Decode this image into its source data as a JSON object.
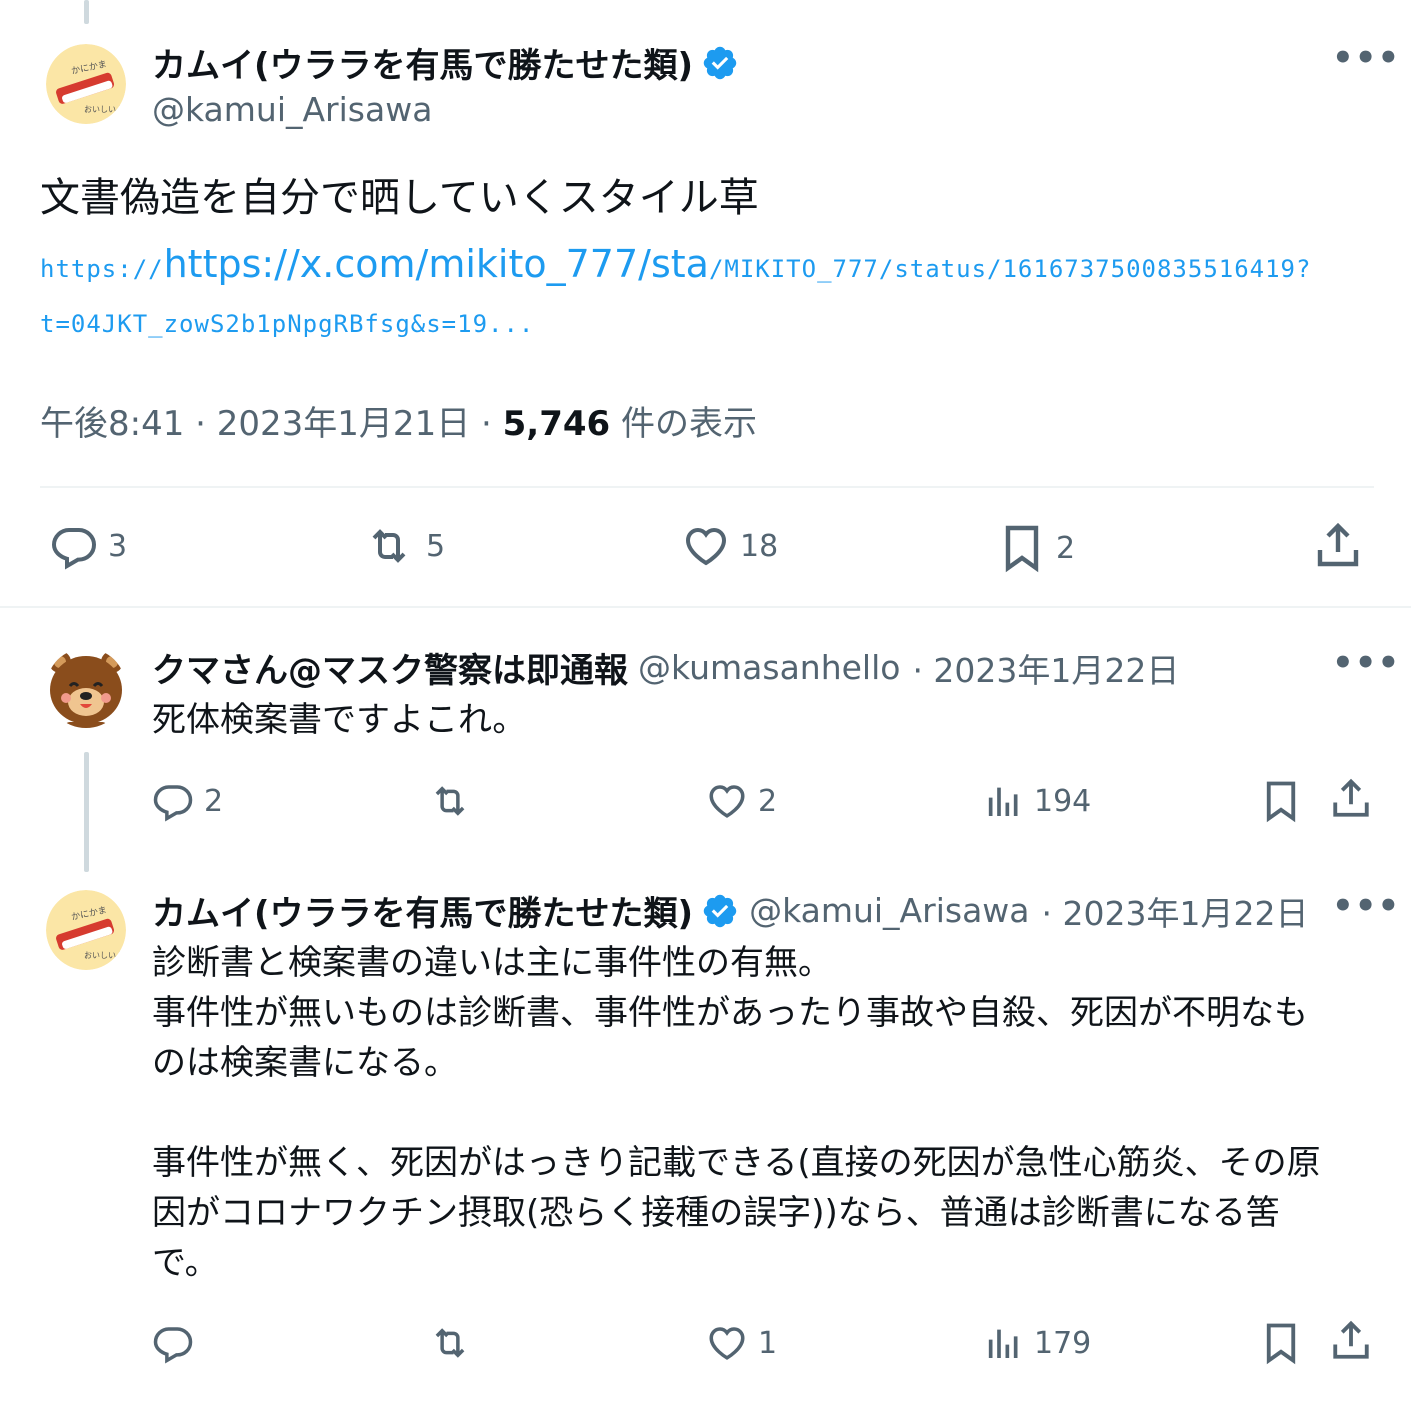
{
  "main_tweet": {
    "display_name": "カムイ(ウララを有馬で勝たせた類)",
    "handle": "@kamui_Arisawa",
    "text": "文書偽造を自分で晒していくスタイル草",
    "link_big": "https://x.com/mikito_777/sta",
    "link_rest": "/MIKITO_777/status/1616737500835516419?",
    "link_line2": "t=04JKT_zowS2b1pNpgRBfsg&s=19...",
    "time": "午後8:41 · 2023年1月21日 · ",
    "views_count": "5,746",
    "views_label": " 件の表示",
    "actions": {
      "replies": "3",
      "retweets": "5",
      "likes": "18",
      "bookmarks": "2"
    }
  },
  "reply1": {
    "display_name": "クマさん@マスク警察は即通報",
    "handle": "@kumasanhello",
    "date": "· 2023年1月22日",
    "text": "死体検案書ですよこれ。",
    "actions": {
      "replies": "2",
      "retweets": "",
      "likes": "2",
      "views": "194"
    }
  },
  "reply2": {
    "display_name": "カムイ(ウララを有馬で勝たせた類)",
    "handle": "@kamui_Arisawa",
    "date": "· 2023年1月22日",
    "text": "診断書と検案書の違いは主に事件性の有無。\n事件性が無いものは診断書、事件性があったり事故や自殺、死因が不明なも\nのは検案書になる。\n\n事件性が無く、死因がはっきり記載できる(直接の死因が急性心筋炎、その原\n因がコロナワクチン摂取(恐らく接種の誤字))なら、普通は診断書になる筈\nで。",
    "actions": {
      "replies": "",
      "retweets": "",
      "likes": "1",
      "views": "179"
    }
  },
  "avatar_text": {
    "kamui_top": "かにかま",
    "kamui_bottom": "おいしいよ"
  },
  "icons": [
    "more-icon",
    "verified-icon",
    "reply-icon",
    "retweet-icon",
    "like-icon",
    "bookmark-icon",
    "share-icon",
    "views-icon"
  ],
  "colors": {
    "link": "#1d9bf0",
    "verified": "#1d9bf0",
    "secondary_text": "#536471",
    "text": "#0f1419"
  }
}
